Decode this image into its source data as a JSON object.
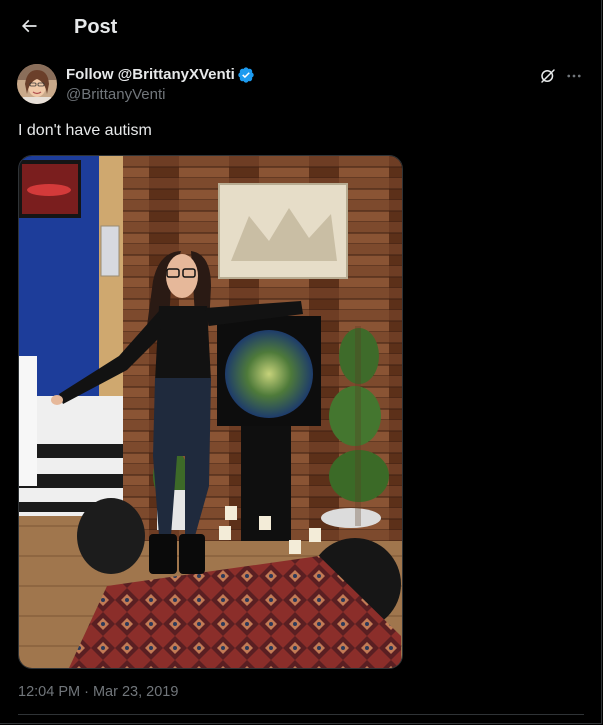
{
  "header": {
    "title": "Post",
    "back_icon": "arrow-left-icon"
  },
  "author": {
    "display_name": "Follow @BrittanyXVenti",
    "handle": "@BrittanyVenti",
    "verified": true
  },
  "post": {
    "text": "I don't have autism",
    "timestamp": "12:04 PM · Mar 23, 2019",
    "image_alt": "Photo of a woman standing next to a round fish tank in a room with wood-paneled wall"
  },
  "actions": {
    "grok_icon": "grok-icon",
    "more_icon": "more-horizontal-icon"
  },
  "colors": {
    "background": "#000000",
    "text_primary": "#e7e9ea",
    "text_secondary": "#71767b",
    "verified": "#1d9bf0",
    "border": "#2f3336"
  }
}
